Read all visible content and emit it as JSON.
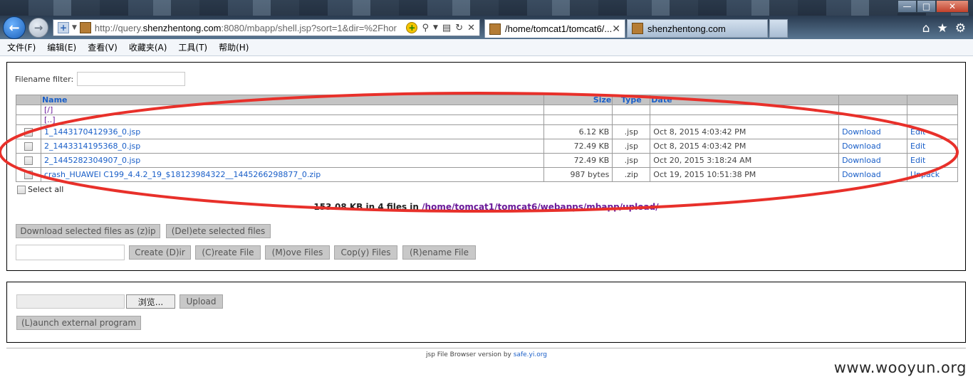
{
  "browser": {
    "url_prefix": "http://query.",
    "url_domain": "shenzhentong.com",
    "url_suffix": ":8080/mbapp/shell.jsp?sort=1&dir=%2Fhor",
    "tabs": [
      {
        "label": "/home/tomcat1/tomcat6/..."
      },
      {
        "label": "shenzhentong.com"
      }
    ],
    "menu": [
      "文件(F)",
      "编辑(E)",
      "查看(V)",
      "收藏夹(A)",
      "工具(T)",
      "帮助(H)"
    ]
  },
  "filter": {
    "label": "Filename filter:",
    "value": ""
  },
  "table": {
    "headers": {
      "name": "Name",
      "size": "Size",
      "type": "Type",
      "date": "Date"
    },
    "parent_links": [
      "[/]",
      "[..]"
    ],
    "rows": [
      {
        "name": "1_1443170412936_0.jsp",
        "size": "6.12 KB",
        "type": ".jsp",
        "date": "Oct 8, 2015 4:03:42 PM",
        "action1": "Download",
        "action2": "Edit"
      },
      {
        "name": "2_1443314195368_0.jsp",
        "size": "72.49 KB",
        "type": ".jsp",
        "date": "Oct 8, 2015 4:03:42 PM",
        "action1": "Download",
        "action2": "Edit"
      },
      {
        "name": "2_1445282304907_0.jsp",
        "size": "72.49 KB",
        "type": ".jsp",
        "date": "Oct 20, 2015 3:18:24 AM",
        "action1": "Download",
        "action2": "Edit"
      },
      {
        "name": "crash_HUAWEI C199_4.4.2_19_$18123984322__1445266298877_0.zip",
        "size": "987 bytes",
        "type": ".zip",
        "date": "Oct 19, 2015 10:51:38 PM",
        "action1": "Download",
        "action2": "Unpack"
      }
    ]
  },
  "select_all": "Select all",
  "summary": {
    "prefix": "153.08 KB in 4 files in ",
    "path": "/home/tomcat1/tomcat6/webapps/mbapp/upload/"
  },
  "buttons": {
    "download_zip": "Download selected files as (z)ip",
    "delete": "(Del)ete selected files",
    "create_dir": "Create (D)ir",
    "create_file": "(C)reate File",
    "move": "(M)ove Files",
    "copy": "Cop(y) Files",
    "rename": "(R)ename File",
    "browse": "浏览...",
    "upload": "Upload",
    "launch": "(L)aunch external program"
  },
  "footer": {
    "text": "jsp File Browser version by ",
    "link": "safe.yi.org"
  },
  "watermark": "www.wooyun.org",
  "colors": {
    "link": "#1a5fc8",
    "dir": "#6a1a9a",
    "annotation": "#e8302a"
  }
}
